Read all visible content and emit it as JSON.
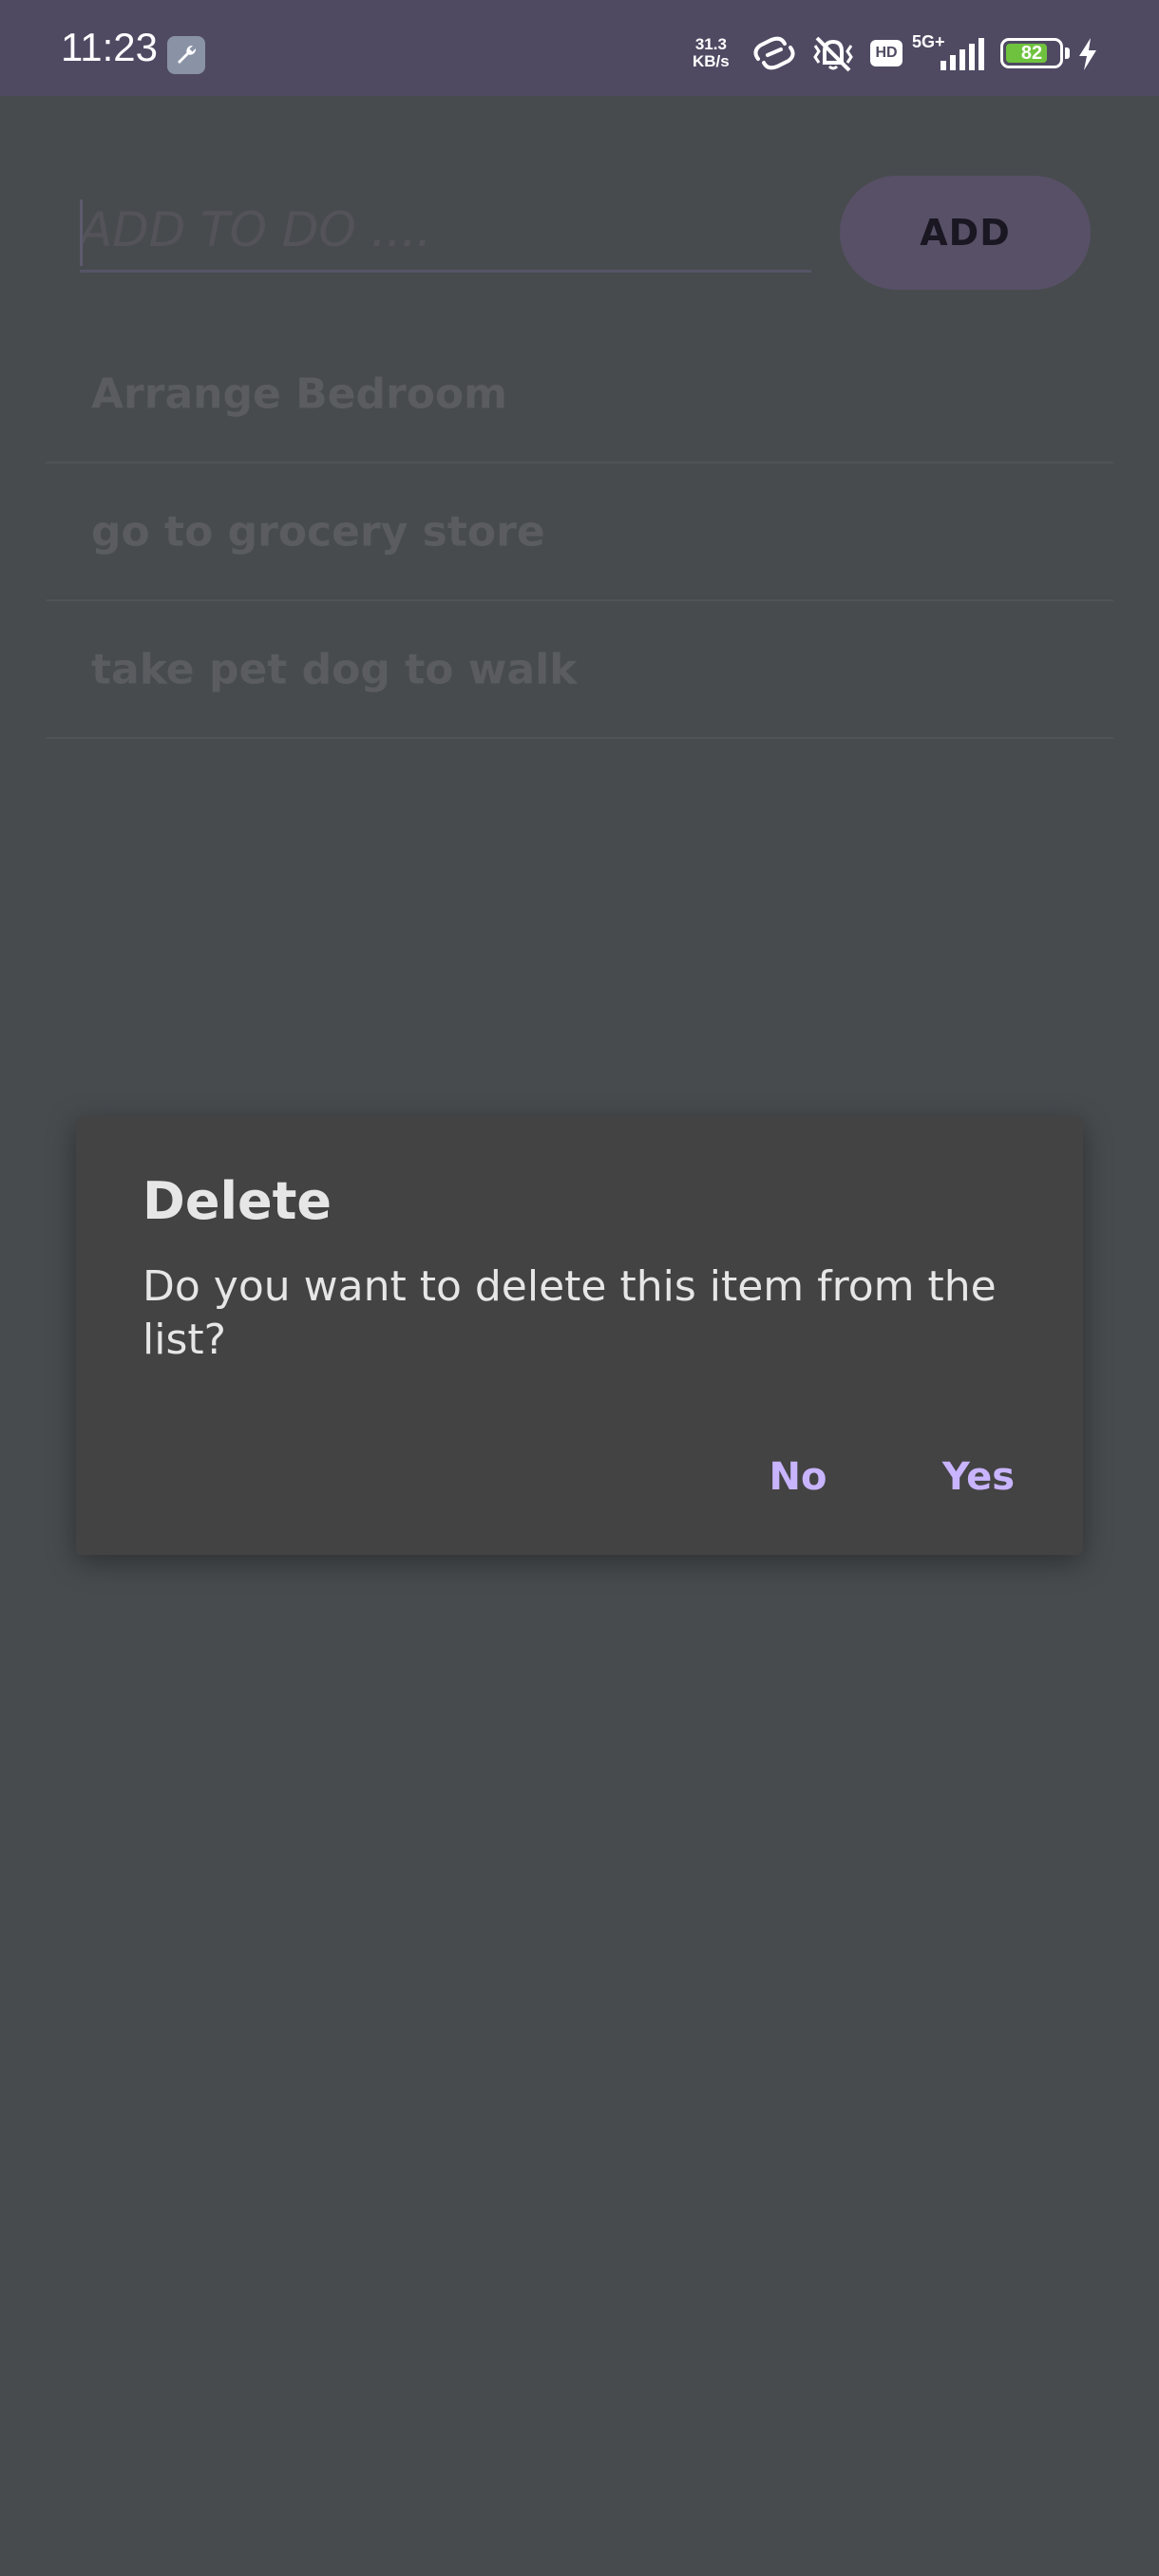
{
  "status_bar": {
    "time": "11:23",
    "net_speed_value": "31.3",
    "net_speed_unit": "KB/s",
    "hd_label": "HD",
    "network_label": "5G+",
    "battery_level": "82",
    "icons": [
      "wrench-icon",
      "link-icon",
      "vibrate-icon",
      "signal-icon",
      "charging-icon"
    ]
  },
  "input": {
    "placeholder": "ADD TO DO ....",
    "value": ""
  },
  "add_button": {
    "label": "ADD"
  },
  "todos": [
    {
      "label": "Arrange Bedroom"
    },
    {
      "label": "go to grocery store"
    },
    {
      "label": "take pet dog to walk"
    }
  ],
  "dialog": {
    "title": "Delete",
    "message": "Do you want to delete this item from the list?",
    "no_label": "No",
    "yes_label": "Yes"
  },
  "colors": {
    "background": "#474b4e",
    "status_bar": "#4f4a62",
    "dialog_bg": "#434343",
    "dialog_accent": "#c8b4ff",
    "battery": "#6fc23e"
  }
}
